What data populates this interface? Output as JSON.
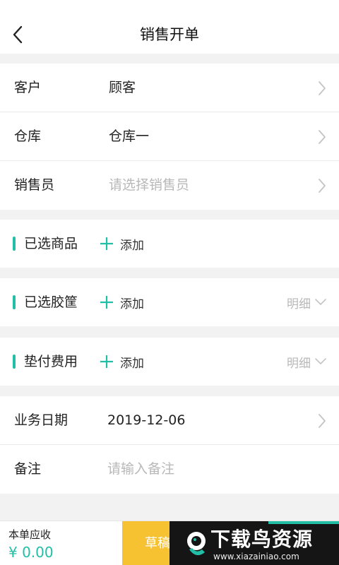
{
  "header": {
    "title": "销售开单"
  },
  "info_group": {
    "customer": {
      "label": "客户",
      "value": "顾客"
    },
    "warehouse": {
      "label": "仓库",
      "value": "仓库一"
    },
    "salesperson": {
      "label": "销售员",
      "placeholder": "请选择销售员"
    }
  },
  "sections": {
    "goods": {
      "label": "已选商品",
      "add_label": "添加"
    },
    "baskets": {
      "label": "已选胶筐",
      "add_label": "添加",
      "detail_label": "明细"
    },
    "advance_fees": {
      "label": "垫付费用",
      "add_label": "添加",
      "detail_label": "明细"
    }
  },
  "date_group": {
    "business_date": {
      "label": "业务日期",
      "value": "2019-12-06"
    },
    "remark": {
      "label": "备注",
      "placeholder": "请输入备注"
    }
  },
  "footer": {
    "due_label": "本单应收",
    "due_amount": "¥ 0.00",
    "draft_label": "草稿"
  },
  "watermark": {
    "main_text": "下载鸟资源",
    "sub_text": "www.xiazainiao.com"
  },
  "colors": {
    "accent": "#22bfa6",
    "draft": "#f6c232",
    "placeholder": "#b8b8b8",
    "background": "#f2f2f2"
  }
}
